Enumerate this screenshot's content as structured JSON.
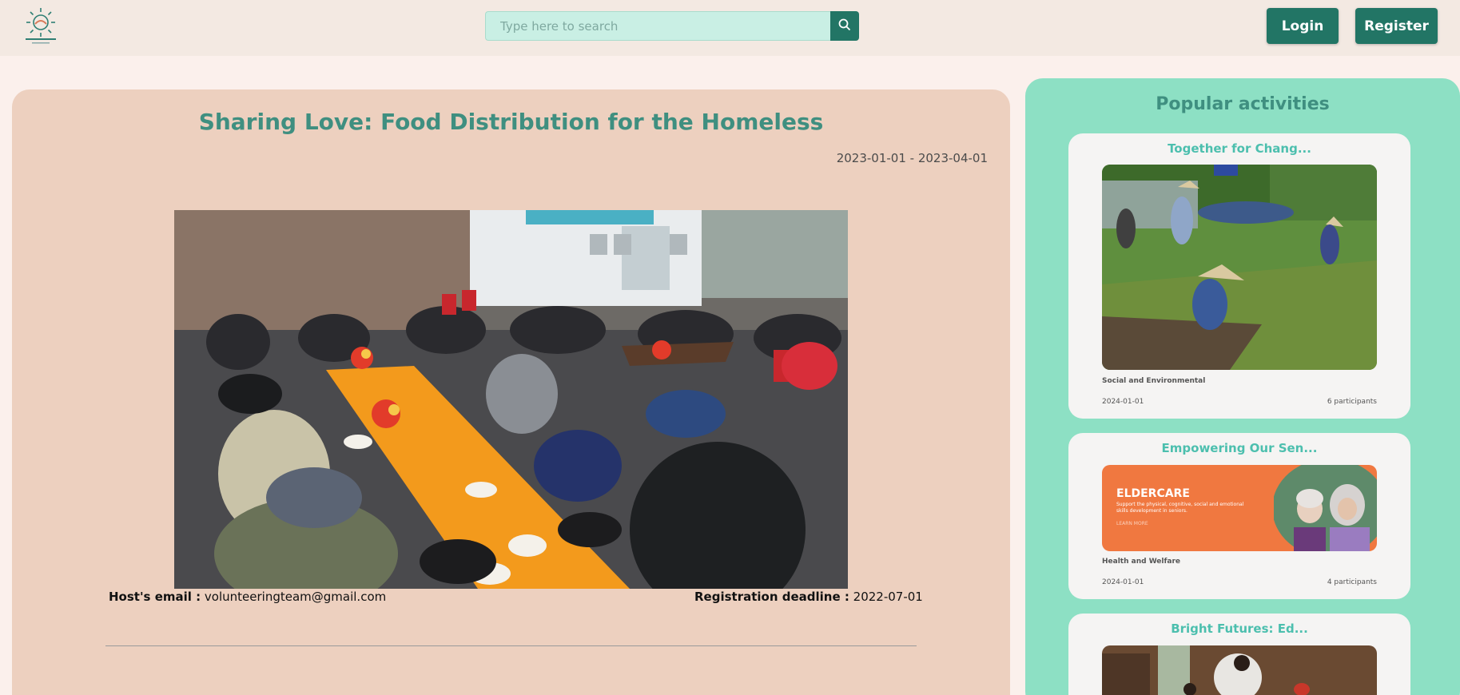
{
  "header": {
    "search_placeholder": "Type here to search",
    "login_label": "Login",
    "register_label": "Register",
    "search_icon": "search-icon",
    "accent_color": "#227565"
  },
  "activity": {
    "title": "Sharing Love: Food Distribution for the Homeless",
    "date_range": "2023-01-01 - 2023-04-01",
    "host_email_label": "Host's email :",
    "host_email": "volunteeringteam@gmail.com",
    "deadline_label": "Registration deadline :",
    "deadline": "2022-07-01"
  },
  "sidebar": {
    "title": "Popular activities",
    "cards": [
      {
        "title": "Together for Chang...",
        "category": "Social and Environmental",
        "date": "2024-01-01",
        "participants": "6 participants"
      },
      {
        "title": "Empowering Our Sen...",
        "category": "Health and Welfare",
        "date": "2024-01-01",
        "participants": "4 participants",
        "banner_title": "ELDERCARE",
        "banner_text": "Support the physical, cognitive, social and emotional skills development in seniors.",
        "banner_link": "LEARN MORE"
      },
      {
        "title": "Bright Futures: Ed..."
      }
    ]
  }
}
